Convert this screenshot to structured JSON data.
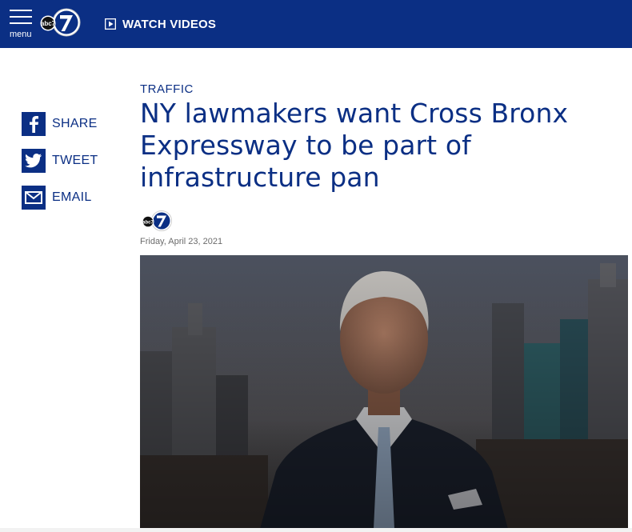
{
  "header": {
    "menu_label": "menu",
    "logo_text": "abc7",
    "watch_label": "WATCH VIDEOS"
  },
  "share": [
    {
      "label": "SHARE",
      "icon": "facebook-icon"
    },
    {
      "label": "TWEET",
      "icon": "twitter-icon"
    },
    {
      "label": "EMAIL",
      "icon": "email-icon"
    }
  ],
  "article": {
    "category": "TRAFFIC",
    "headline": "NY lawmakers want Cross Bronx Expressway to be part of infrastructure pan",
    "byline_logo": "abc7",
    "date": "Friday, April 23, 2021",
    "hero_image": "news-anchor-city-skyline-image"
  },
  "colors": {
    "brand": "#0b2f84",
    "date": "#6b6b6b"
  }
}
